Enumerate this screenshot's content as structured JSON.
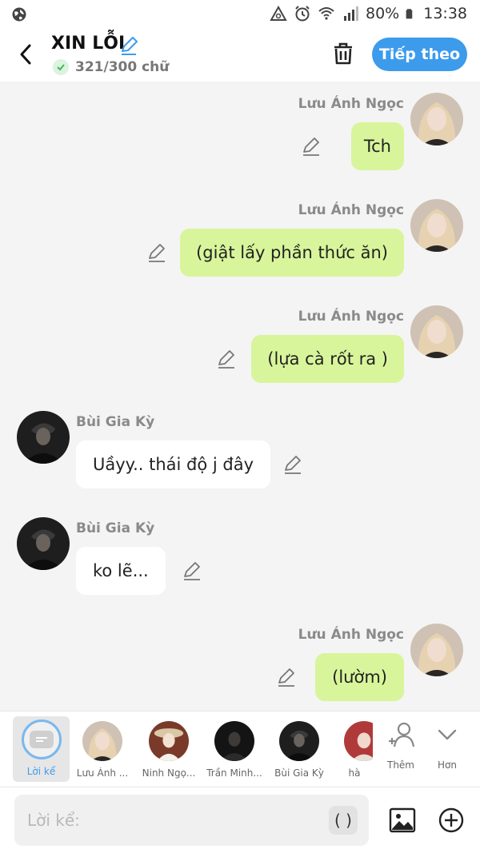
{
  "status_bar": {
    "battery": "80%",
    "time": "13:38",
    "icons": [
      "globe-icon",
      "data-saver-icon",
      "alarm-icon",
      "wifi-icon",
      "signal-icon",
      "battery-icon"
    ]
  },
  "header": {
    "title": "XIN LỖI",
    "char_count": "321/300 chữ",
    "next_label": "Tiếp theo",
    "accent_color": "#3d9bec"
  },
  "messages": [
    {
      "side": "right",
      "sender": "Lưu Ánh Ngọc",
      "text": "Tch"
    },
    {
      "side": "right",
      "sender": "Lưu Ánh Ngọc",
      "text": "(giật lấy phần thức ăn)"
    },
    {
      "side": "right",
      "sender": "Lưu Ánh Ngọc",
      "text": "(lựa cà rốt ra )"
    },
    {
      "side": "left",
      "sender": "Bùi Gia Kỳ",
      "text": "Uầyy.. thái độ j đây"
    },
    {
      "side": "left",
      "sender": "Bùi Gia Kỳ",
      "text": "ko lẽ..."
    },
    {
      "side": "right",
      "sender": "Lưu Ánh Ngọc",
      "text": "(lườm)"
    }
  ],
  "characters": [
    {
      "name": "Lời kể",
      "selected": true
    },
    {
      "name": "Lưu Ánh ..."
    },
    {
      "name": "Ninh Ngọ..."
    },
    {
      "name": "Trần Minh..."
    },
    {
      "name": "Bùi Gia Kỳ"
    },
    {
      "name": "hà"
    }
  ],
  "tools": {
    "add_label": "Thêm",
    "more_label": "Hơn"
  },
  "input": {
    "placeholder": "Lời kể:",
    "paren_label": "( )"
  },
  "colors": {
    "my_bubble": "#d8f59b",
    "their_bubble": "#ffffff",
    "background": "#f4f4f4"
  }
}
